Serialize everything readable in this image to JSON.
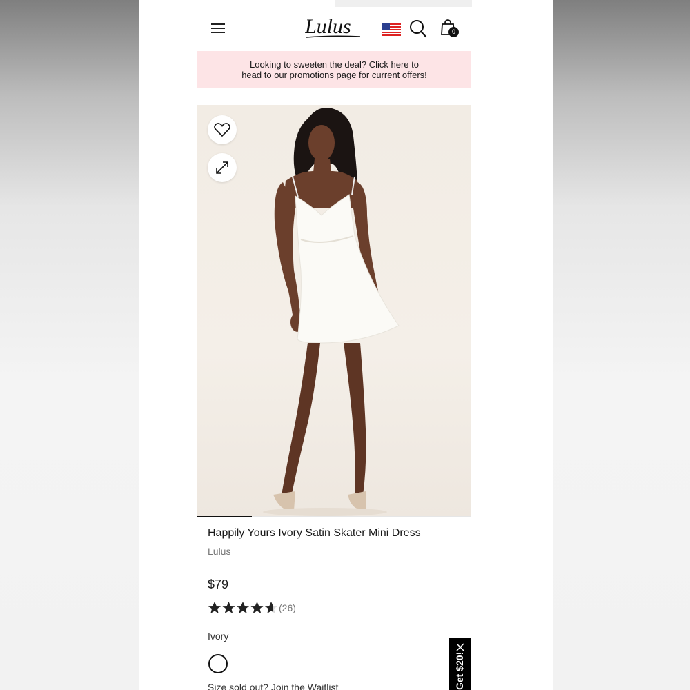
{
  "header": {
    "logo_text": "Lulus",
    "cart_count": "0",
    "icons": [
      "hamburger-menu-icon",
      "us-flag-icon",
      "search-icon",
      "shopping-bag-icon"
    ]
  },
  "promo": {
    "line1": "Looking to sweeten the deal? Click here to",
    "line2": "head to our promotions page for current offers!"
  },
  "gallery": {
    "icons": [
      "heart-icon",
      "expand-icon"
    ],
    "progress_fraction": 0.2
  },
  "product": {
    "title": "Happily Yours Ivory Satin Skater Mini Dress",
    "brand": "Lulus",
    "price": "$79",
    "rating_value": 4.6,
    "rating_count": "(26)",
    "color_label": "Ivory",
    "waitlist_prefix": "Size sold out?",
    "waitlist_link": "Join the Waitlist"
  },
  "side_tab": {
    "text": "Get $20!"
  },
  "colors": {
    "promo_bg": "#fde4e6",
    "text": "#1a1a1a",
    "muted": "#777777",
    "star": "#222222"
  }
}
